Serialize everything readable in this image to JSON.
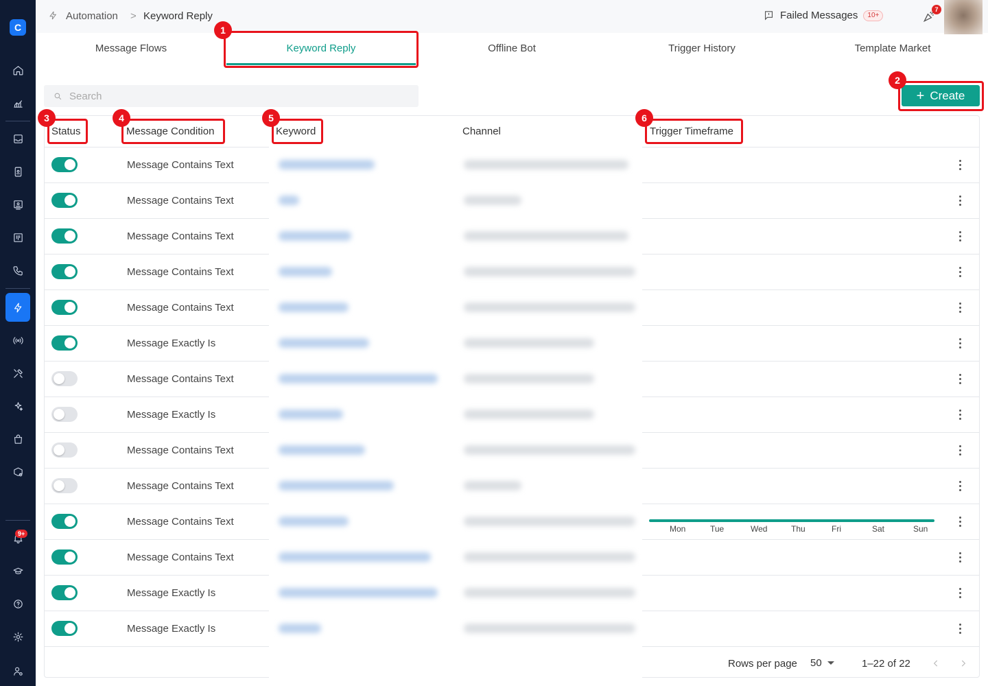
{
  "breadcrumb": {
    "root": "Automation",
    "separator": ">",
    "current": "Keyword Reply"
  },
  "topbar": {
    "failed_messages_label": "Failed Messages",
    "failed_badge": "10+",
    "notification_count": "7"
  },
  "sidebar": {
    "logo": "C",
    "notification_badge": "9+"
  },
  "tabs": [
    {
      "label": "Message Flows"
    },
    {
      "label": "Keyword Reply"
    },
    {
      "label": "Offline Bot"
    },
    {
      "label": "Trigger History"
    },
    {
      "label": "Template Market"
    }
  ],
  "search": {
    "placeholder": "Search"
  },
  "create_button": {
    "label": "Create"
  },
  "table": {
    "headers": {
      "status": "Status",
      "condition": "Message Condition",
      "keyword": "Keyword",
      "channel": "Channel",
      "timeframe": "Trigger Timeframe"
    },
    "rows": [
      {
        "enabled": true,
        "condition": "Message Contains Text"
      },
      {
        "enabled": true,
        "condition": "Message Contains Text"
      },
      {
        "enabled": true,
        "condition": "Message Contains Text"
      },
      {
        "enabled": true,
        "condition": "Message Contains Text"
      },
      {
        "enabled": true,
        "condition": "Message Contains Text"
      },
      {
        "enabled": true,
        "condition": "Message Exactly Is"
      },
      {
        "enabled": false,
        "condition": "Message Contains Text"
      },
      {
        "enabled": false,
        "condition": "Message Exactly Is"
      },
      {
        "enabled": false,
        "condition": "Message Contains Text"
      },
      {
        "enabled": false,
        "condition": "Message Contains Text"
      },
      {
        "enabled": true,
        "condition": "Message Contains Text"
      },
      {
        "enabled": true,
        "condition": "Message Contains Text"
      },
      {
        "enabled": true,
        "condition": "Message Exactly Is"
      },
      {
        "enabled": true,
        "condition": "Message Exactly Is"
      }
    ],
    "timeframe_days": [
      "Mon",
      "Tue",
      "Wed",
      "Thu",
      "Fri",
      "Sat",
      "Sun"
    ]
  },
  "pagination": {
    "rows_per_page_label": "Rows per page",
    "rows_per_page_value": "50",
    "range": "1–22 of 22"
  },
  "annotations": [
    "1",
    "2",
    "3",
    "4",
    "5",
    "6"
  ],
  "colors": {
    "accent": "#0f9d8a",
    "sidebar_bg": "#0f1b33",
    "callout": "#e8141c",
    "sidebar_active": "#1976f5"
  }
}
